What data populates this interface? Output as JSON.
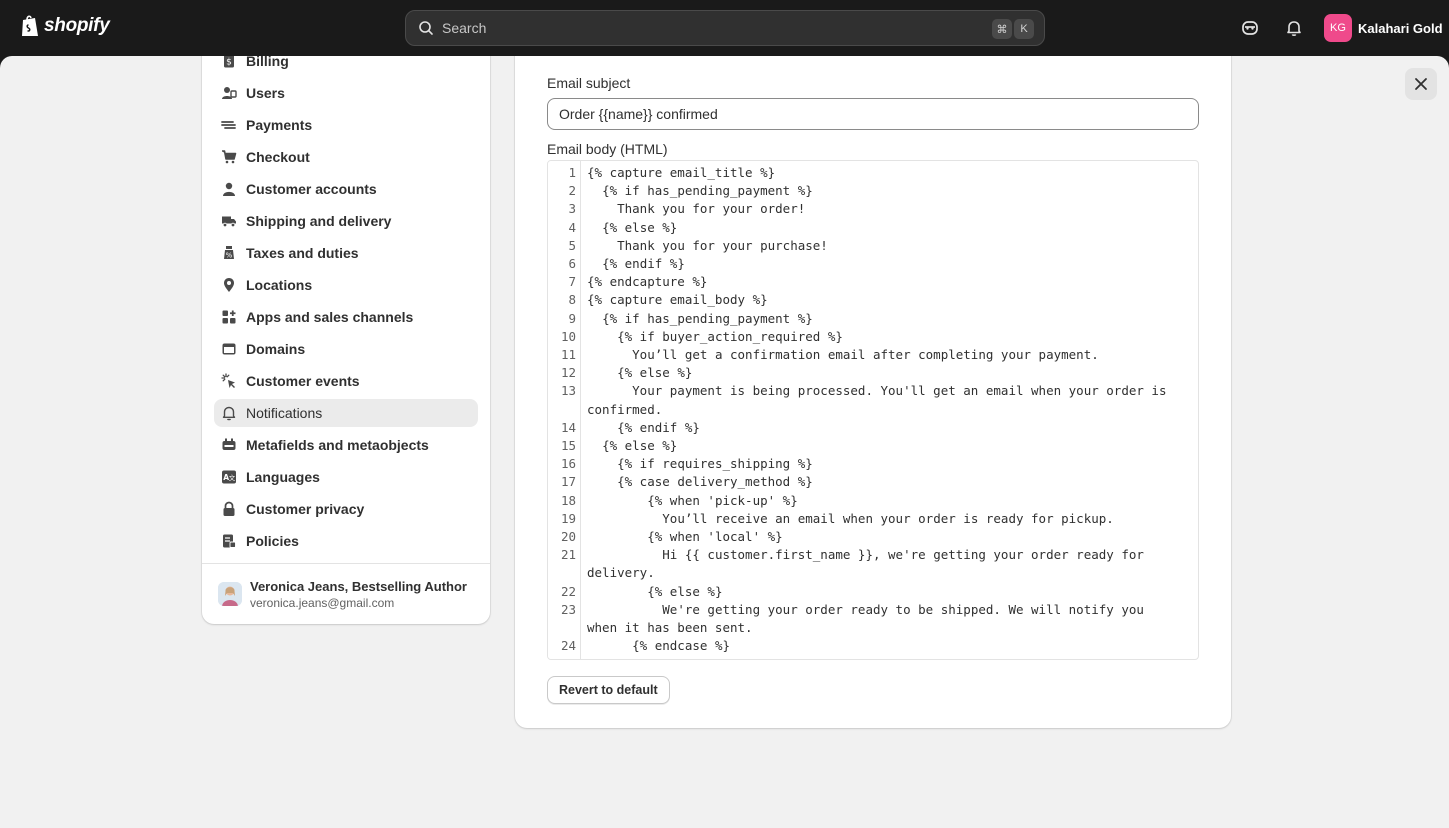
{
  "brand": {
    "logo_text": "shopify",
    "accent": "#ef4a8b"
  },
  "search": {
    "placeholder": "Search",
    "shortcut_cmd": "⌘",
    "shortcut_key": "K"
  },
  "account": {
    "initials": "KG",
    "store_name": "Kalahari Gold"
  },
  "sidebar": {
    "items": [
      {
        "label": "Billing",
        "icon": "billing-icon"
      },
      {
        "label": "Users",
        "icon": "users-icon"
      },
      {
        "label": "Payments",
        "icon": "payments-icon"
      },
      {
        "label": "Checkout",
        "icon": "cart-icon"
      },
      {
        "label": "Customer accounts",
        "icon": "person-icon"
      },
      {
        "label": "Shipping and delivery",
        "icon": "truck-icon"
      },
      {
        "label": "Taxes and duties",
        "icon": "taxes-icon"
      },
      {
        "label": "Locations",
        "icon": "location-pin-icon"
      },
      {
        "label": "Apps and sales channels",
        "icon": "apps-icon"
      },
      {
        "label": "Domains",
        "icon": "domains-icon"
      },
      {
        "label": "Customer events",
        "icon": "cursor-click-icon"
      },
      {
        "label": "Notifications",
        "icon": "bell-icon",
        "active": true
      },
      {
        "label": "Metafields and metaobjects",
        "icon": "metafields-icon"
      },
      {
        "label": "Languages",
        "icon": "language-icon"
      },
      {
        "label": "Customer privacy",
        "icon": "lock-icon"
      },
      {
        "label": "Policies",
        "icon": "policies-icon"
      }
    ],
    "footer": {
      "name": "Veronica Jeans, Bestselling Author",
      "email": "veronica.jeans@gmail.com"
    }
  },
  "main": {
    "subject_label": "Email subject",
    "subject_value": "Order {{name}} confirmed",
    "body_label": "Email body (HTML)",
    "code_lines": [
      "{% capture email_title %}",
      "  {% if has_pending_payment %}",
      "    Thank you for your order!",
      "  {% else %}",
      "    Thank you for your purchase!",
      "  {% endif %}",
      "{% endcapture %}",
      "{% capture email_body %}",
      "  {% if has_pending_payment %}",
      "    {% if buyer_action_required %}",
      "      You’ll get a confirmation email after completing your payment.",
      "    {% else %}",
      "      Your payment is being processed. You'll get an email when your order is confirmed.",
      "    {% endif %}",
      "  {% else %}",
      "    {% if requires_shipping %}",
      "    {% case delivery_method %}",
      "        {% when 'pick-up' %}",
      "          You’ll receive an email when your order is ready for pickup.",
      "        {% when 'local' %}",
      "          Hi {{ customer.first_name }}, we're getting your order ready for delivery.",
      "        {% else %}",
      "          We're getting your order ready to be shipped. We will notify you when it has been sent.",
      "      {% endcase %}"
    ],
    "revert_label": "Revert to default"
  }
}
